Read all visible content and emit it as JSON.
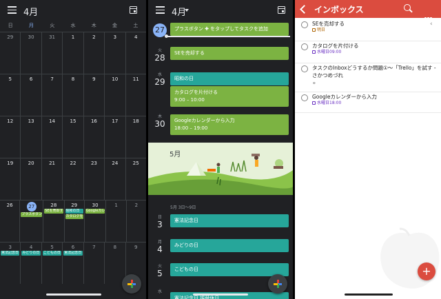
{
  "month_view": {
    "title": "4月",
    "weekdays": [
      "日",
      "月",
      "火",
      "水",
      "木",
      "金",
      "土"
    ],
    "weeks": [
      [
        {
          "n": "29"
        },
        {
          "n": "30"
        },
        {
          "n": "31"
        },
        {
          "n": "1"
        },
        {
          "n": "2"
        },
        {
          "n": "3"
        },
        {
          "n": "4"
        }
      ],
      [
        {
          "n": "5"
        },
        {
          "n": "6"
        },
        {
          "n": "7"
        },
        {
          "n": "8"
        },
        {
          "n": "9"
        },
        {
          "n": "10"
        },
        {
          "n": "11"
        }
      ],
      [
        {
          "n": "12"
        },
        {
          "n": "13"
        },
        {
          "n": "14"
        },
        {
          "n": "15"
        },
        {
          "n": "16"
        },
        {
          "n": "17"
        },
        {
          "n": "18"
        }
      ],
      [
        {
          "n": "19"
        },
        {
          "n": "20"
        },
        {
          "n": "21"
        },
        {
          "n": "22"
        },
        {
          "n": "23"
        },
        {
          "n": "24"
        },
        {
          "n": "25"
        }
      ],
      [
        {
          "n": "26"
        },
        {
          "n": "27",
          "today": true,
          "events": [
            {
              "t": "プラスボタン",
              "c": "g"
            }
          ]
        },
        {
          "n": "28",
          "events": [
            {
              "t": "SEを売却す",
              "c": "g"
            }
          ]
        },
        {
          "n": "29",
          "events": [
            {
              "t": "昭和の日",
              "c": "t"
            },
            {
              "t": "カタログを",
              "c": "g"
            }
          ]
        },
        {
          "n": "30",
          "events": [
            {
              "t": "Googleカレ",
              "c": "g"
            }
          ]
        },
        {
          "n": "1"
        },
        {
          "n": "2"
        }
      ],
      [
        {
          "n": "3",
          "events": [
            {
              "t": "憲法記念日",
              "c": "t"
            }
          ]
        },
        {
          "n": "4",
          "events": [
            {
              "t": "みどりの日",
              "c": "t"
            }
          ]
        },
        {
          "n": "5",
          "events": [
            {
              "t": "こどもの日",
              "c": "t"
            }
          ]
        },
        {
          "n": "6",
          "events": [
            {
              "t": "憲法記念日",
              "c": "t"
            }
          ]
        },
        {
          "n": "7"
        },
        {
          "n": "8"
        },
        {
          "n": "9"
        }
      ]
    ]
  },
  "schedule_view": {
    "title": "4月",
    "days": [
      {
        "dw": "",
        "dn": "27",
        "today": true
      },
      {
        "dw": "火",
        "dn": "28"
      },
      {
        "dw": "水",
        "dn": "29"
      },
      {
        "dw": "木",
        "dn": "30"
      },
      {
        "dw": "日",
        "dn": "3"
      },
      {
        "dw": "月",
        "dn": "4"
      },
      {
        "dw": "火",
        "dn": "5"
      },
      {
        "dw": "水",
        "dn": ""
      }
    ],
    "events": [
      {
        "title": "プラスボタン ✚ をタップしてタスクを追加",
        "time": "",
        "color": "g"
      },
      {
        "title": "SEを売却する",
        "time": "",
        "color": "g"
      },
      {
        "title": "昭和の日",
        "time": "",
        "color": "t"
      },
      {
        "title": "カタログを片付ける",
        "time": "9:00 – 10:00",
        "color": "g"
      },
      {
        "title": "Googleカレンダーから入力",
        "time": "18:00 – 19:00",
        "color": "g"
      },
      {
        "title": "憲法記念日",
        "time": "",
        "color": "t"
      },
      {
        "title": "みどりの日",
        "time": "",
        "color": "t"
      },
      {
        "title": "こどもの日",
        "time": "",
        "color": "t"
      },
      {
        "title": "憲法記念日 振替休日",
        "time": "",
        "color": "t"
      }
    ],
    "banner_month": "5月",
    "week_range": "5月 3日～9日"
  },
  "inbox": {
    "title": "インボックス",
    "tasks": [
      {
        "text": "SEを売却する",
        "due": "明日",
        "due_color": "orange"
      },
      {
        "text": "カタログを片付ける",
        "due": "水曜日09:00",
        "due_color": "purple"
      },
      {
        "text": "タスクのInboxどうするか問題①〜「Trello」を試す - さかつめづれ",
        "due": "",
        "due_color": ""
      },
      {
        "text": "Googleカレンダーから入力",
        "due": "水曜日18:00",
        "due_color": "purple"
      }
    ]
  },
  "colors": {
    "today": "#8ab4f8",
    "green_event": "#7cb342",
    "teal_event": "#26a69a",
    "todoist_red": "#db4c3f"
  },
  "icons": [
    "menu-icon",
    "calendar-icon",
    "dropdown-icon",
    "back-icon",
    "search-icon",
    "more-icon",
    "plus-icon",
    "link-icon",
    "chevron-left-icon"
  ]
}
